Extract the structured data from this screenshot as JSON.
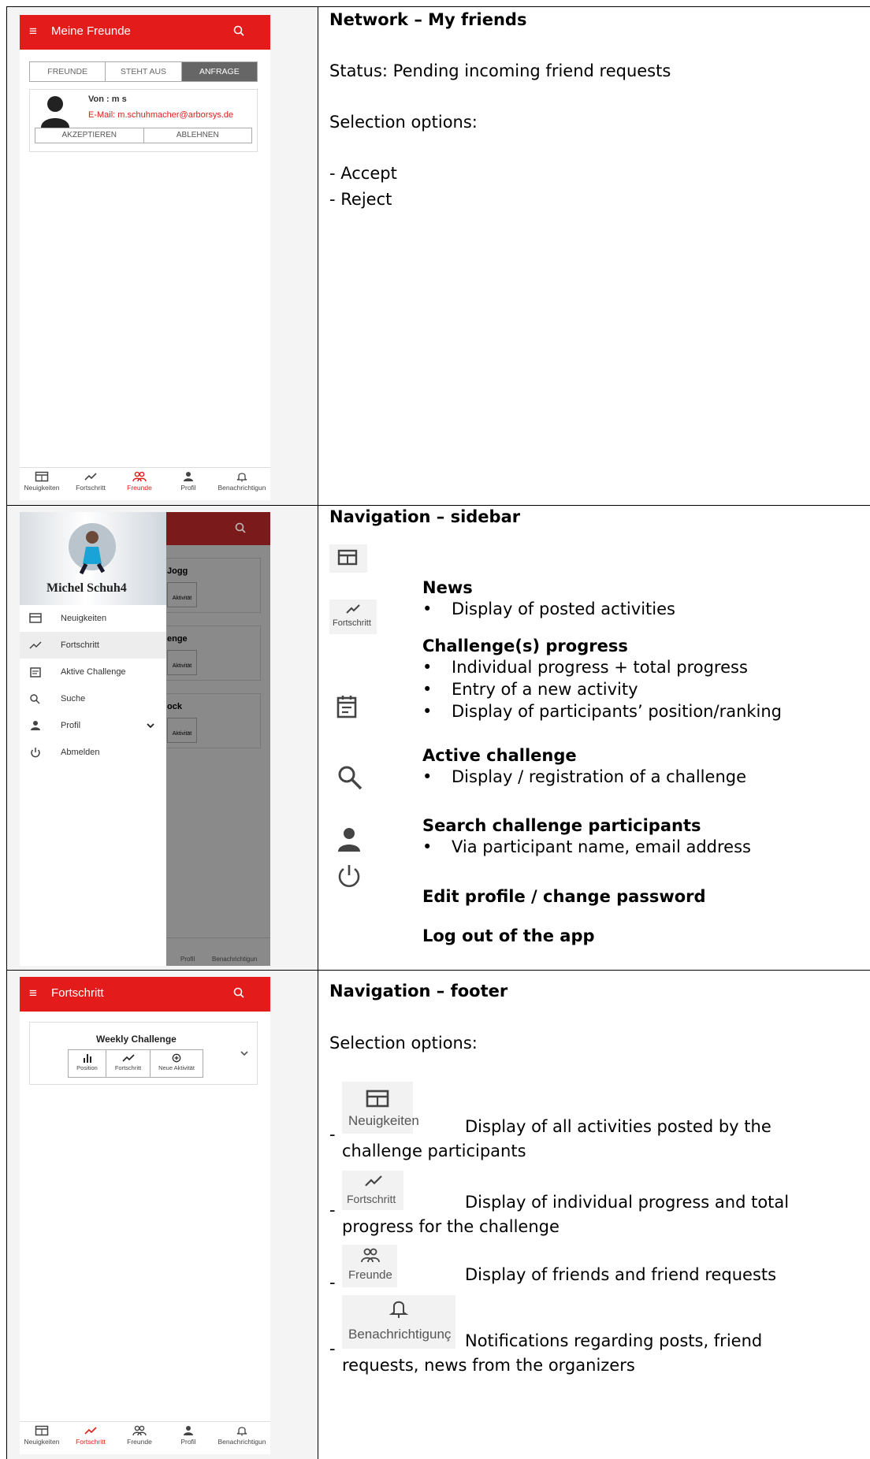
{
  "row1": {
    "screen": {
      "title": "Meine Freunde",
      "tabs": [
        "FREUNDE",
        "STEHT AUS",
        "ANFRAGE"
      ],
      "request_from": "Von : m s",
      "request_email": "E-Mail: m.schuhmacher@arborsys.de",
      "accept_label": "AKZEPTIEREN",
      "reject_label": "ABLEHNEN",
      "footer": [
        "Neuigkeiten",
        "Fortschritt",
        "Freunde",
        "Profil",
        "Benachrichtigun"
      ]
    },
    "desc": {
      "heading": "Network – My friends",
      "status": "Status: Pending incoming friend requests",
      "options_label": "Selection options:",
      "opt1": "- Accept",
      "opt2": "- Reject"
    }
  },
  "row2": {
    "screen": {
      "user_name": "Michel Schuh4",
      "nav": [
        "Neuigkeiten",
        "Fortschritt",
        "Aktive Challenge",
        "Suche",
        "Profil",
        "Abmelden"
      ],
      "bg_cards": [
        "Jogg",
        "enge",
        "ock"
      ],
      "bg_action": "Aktivität",
      "footer": [
        "Profil",
        "Benachrichtigun"
      ]
    },
    "desc": {
      "heading": "Navigation – sidebar",
      "icon_label_progress": "Fortschritt",
      "news_title": "News",
      "news_b1": "Display of posted activities",
      "progress_title": "Challenge(s) progress",
      "progress_b1": "Individual progress + total progress",
      "progress_b2": "Entry of a new activity",
      "progress_b3": "Display of participants’ position/ranking",
      "active_title": "Active challenge",
      "active_b1": "Display / registration of a challenge",
      "search_title": "Search challenge participants",
      "search_b1": "Via participant name, email address",
      "profile_title": "Edit profile / change password",
      "logout_title": "Log out of the app"
    }
  },
  "row3": {
    "screen": {
      "title": "Fortschritt",
      "card_title": "Weekly Challenge",
      "card_actions": [
        "Position",
        "Fortschritt",
        "Neue Aktivität"
      ],
      "footer": [
        "Neuigkeiten",
        "Fortschritt",
        "Freunde",
        "Profil",
        "Benachrichtigun"
      ]
    },
    "desc": {
      "heading": "Navigation – footer",
      "options_label": "Selection options:",
      "icon_news": "Neuigkeiten",
      "icon_progress": "Fortschritt",
      "icon_friends": "Freunde",
      "icon_notif": "Benachrichtigunç",
      "dash": "-",
      "news_text_a": "Display of all activities posted by the",
      "news_text_b": "challenge participants",
      "progress_text_a": "Display of individual progress and total",
      "progress_text_b": "progress for the challenge",
      "friends_text": "Display of friends and friend requests",
      "notif_text_a": "Notifications regarding posts, friend",
      "notif_text_b": "requests, news from the organizers"
    }
  },
  "colors": {
    "accent": "#e41b1b",
    "email": "#e41b1b"
  }
}
